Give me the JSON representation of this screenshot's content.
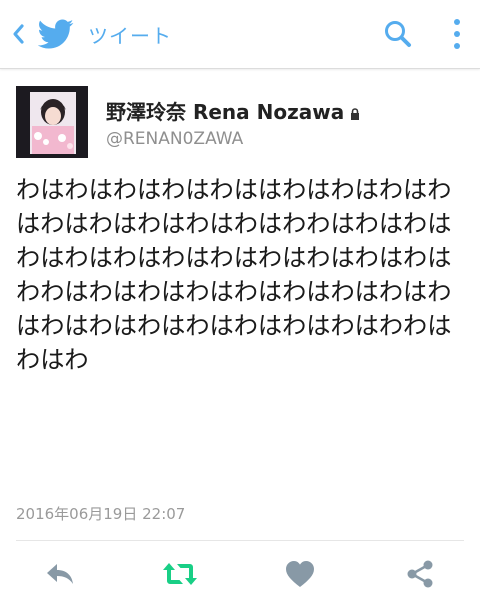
{
  "appbar": {
    "title": "ツイート",
    "back_icon": "chevron-left-icon",
    "logo_icon": "twitter-bird-icon",
    "search_icon": "search-icon",
    "more_icon": "vertical-dots-icon",
    "accent_color": "#55acee"
  },
  "tweet": {
    "display_name": "野澤玲奈 Rena Nozawa",
    "screen_name": "@RENAN0ZAWA",
    "protected": true,
    "text": "わはわはわはわはわははわはわはわはわはわはわはわはわはわはわわはわはわはわはわはわはわはわはわはわはわはわはわわはわはわはわはわはわはわはわはわはわはわはわはわはわはわはわはわわはわはわ",
    "timestamp": "2016年06月19日 22:07"
  },
  "actions": {
    "reply_icon": "reply-icon",
    "retweet_icon": "retweet-icon",
    "retweet_color": "#19cf86",
    "like_icon": "heart-icon",
    "share_icon": "share-icon",
    "icon_color": "#8899a6"
  }
}
